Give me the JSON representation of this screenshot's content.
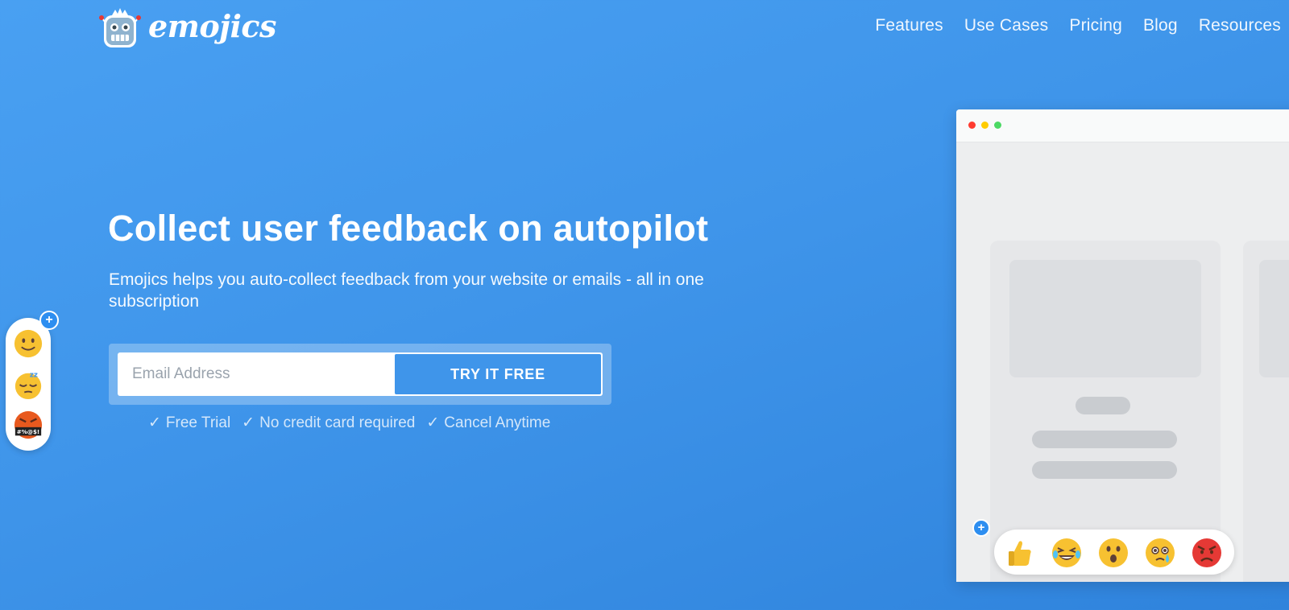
{
  "header": {
    "brand": "emojics",
    "nav": [
      "Features",
      "Use Cases",
      "Pricing",
      "Blog",
      "Resources"
    ]
  },
  "hero": {
    "title": "Collect user feedback on autopilot",
    "subtitle": "Emojics helps you auto-collect feedback from your website or emails - all in one subscription"
  },
  "signup": {
    "email_placeholder": "Email Address",
    "button_label": "TRY IT FREE"
  },
  "benefits": [
    "Free Trial",
    "No credit card required",
    "Cancel Anytime"
  ],
  "side_widget": {
    "plus": "+",
    "emojis": [
      "smile-emoji-icon",
      "sleepy-emoji-icon",
      "cursing-emoji-icon"
    ],
    "cursing_text": "#%@$!"
  },
  "mockup": {
    "window_dots": [
      "#ff3b30",
      "#ffcc00",
      "#4cd964"
    ],
    "plus": "+",
    "reactions": [
      "thumbs-up-icon",
      "laughing-emoji-icon",
      "surprised-emoji-icon",
      "crying-emoji-icon",
      "angry-emoji-icon"
    ]
  },
  "colors": {
    "background": "#3f95ea",
    "button": "#3f95ea",
    "badge": "#2d8ef0"
  }
}
